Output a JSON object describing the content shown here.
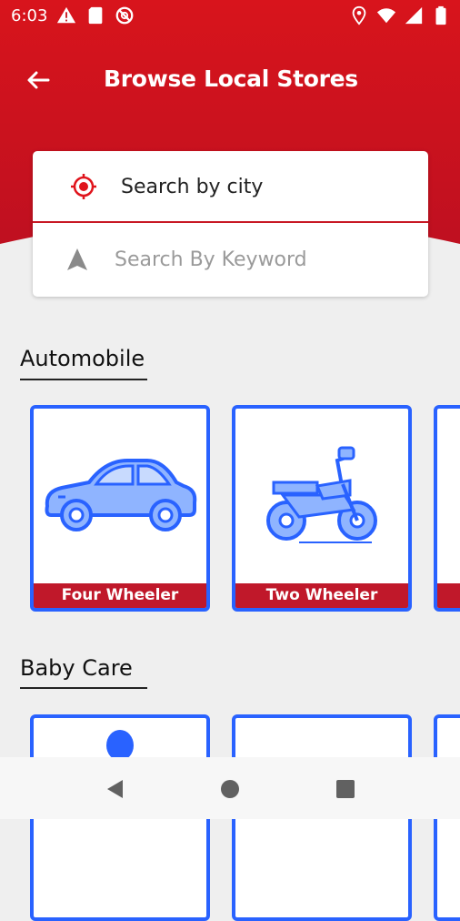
{
  "status_bar": {
    "time": "6:03",
    "left_icons": [
      "warning-icon",
      "sd-card-icon",
      "blocked-icon"
    ],
    "right_icons": [
      "location-pin-icon",
      "wifi-icon",
      "signal-icon",
      "battery-icon"
    ]
  },
  "app_bar": {
    "title": "Browse Local Stores",
    "back_icon": "arrow-left-icon"
  },
  "search": {
    "city_label": "Search by city",
    "city_icon": "target-icon",
    "keyword_placeholder": "Search By Keyword",
    "keyword_value": "",
    "keyword_icon": "navigation-arrow-icon"
  },
  "sections": [
    {
      "title": "Automobile",
      "items": [
        {
          "label": "Four Wheeler",
          "icon": "car-icon"
        },
        {
          "label": "Two Wheeler",
          "icon": "motorcycle-icon"
        }
      ]
    },
    {
      "title": "Baby Care",
      "items": [
        {
          "label": "",
          "icon": "baby-icon"
        },
        {
          "label": "",
          "icon": ""
        }
      ]
    }
  ],
  "nav": {
    "back": "back-triangle-icon",
    "home": "home-circle-icon",
    "recents": "recents-square-icon"
  },
  "colors": {
    "primary_red": "#c8141e",
    "card_border_blue": "#2962ff",
    "label_red": "#c0182a"
  }
}
